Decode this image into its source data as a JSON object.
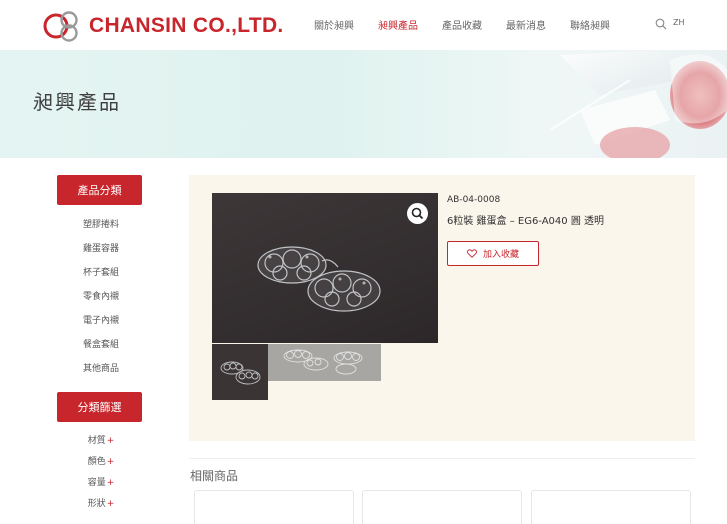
{
  "header": {
    "brand": "CHANSIN CO.,LTD.",
    "nav": [
      "關於昶興",
      "昶興產品",
      "產品收藏",
      "最新消息",
      "聯絡昶興"
    ],
    "active_index": 1,
    "lang": "ZH",
    "icons": {
      "search": "search-icon"
    }
  },
  "banner": {
    "title": "昶興產品"
  },
  "sidebar": {
    "categories_title": "產品分類",
    "categories": [
      "塑膠捲料",
      "雞蛋容器",
      "杯子套組",
      "零食內襯",
      "電子內襯",
      "餐盒套組",
      "其他商品"
    ],
    "filter_title": "分類篩選",
    "filters": [
      "材質",
      "顏色",
      "容量",
      "形狀"
    ],
    "filter_plus": "+"
  },
  "product": {
    "sku": "AB-04-0008",
    "name": "6粒裝 雞蛋盒 – EG6-A040 圓 透明",
    "favorite_label": "加入收藏",
    "icons": {
      "zoom": "magnifier-icon",
      "favorite": "heart-icon"
    }
  },
  "related": {
    "title": "相關商品",
    "card_count": 3
  },
  "colors": {
    "brand": "#c8262d",
    "panel": "#fbf6ec"
  }
}
